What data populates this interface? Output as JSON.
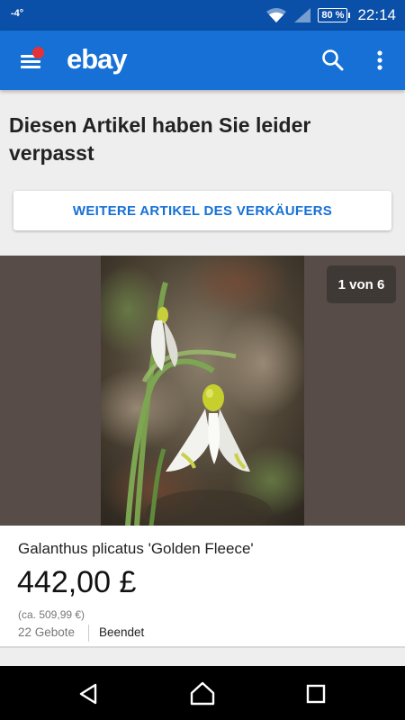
{
  "status_bar": {
    "left_text": "-4°",
    "battery": "80 %",
    "time": "22:14"
  },
  "app_bar": {
    "logo": "ebay",
    "icons": [
      "menu-icon",
      "notification-dot",
      "search-icon",
      "more-vert-icon"
    ]
  },
  "missed": {
    "title": "Diesen Artikel haben Sie leider verpasst",
    "seller_button": "WEITERE ARTIKEL DES VERKÄUFERS"
  },
  "item": {
    "photo_counter": "1 von 6",
    "title": "Galanthus plicatus 'Golden Fleece'",
    "price": "442,00 £",
    "approx_price": "(ca. 509,99 €)",
    "bids": "22 Gebote",
    "status": "Beendet"
  },
  "nav_bar": {
    "icons": [
      "back-icon",
      "home-icon",
      "recents-icon"
    ]
  },
  "colors": {
    "status_bar": "#0a4fa8",
    "app_bar": "#1670d6",
    "accent_link": "#1670d6",
    "notification_dot": "#e53238"
  }
}
